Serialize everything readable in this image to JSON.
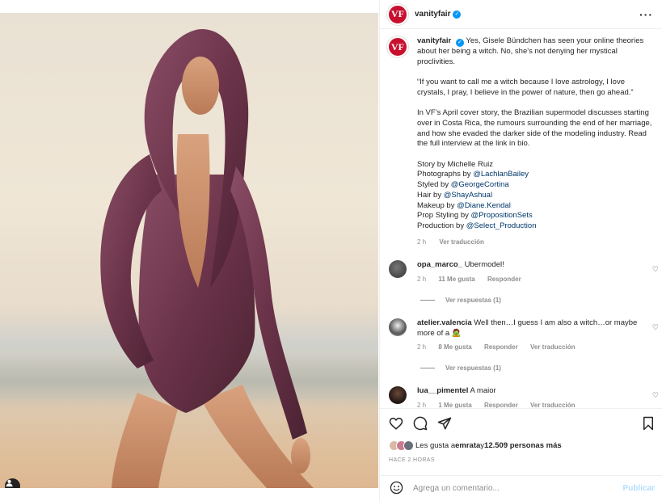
{
  "post": {
    "account": "vanityfair",
    "avatar_text": "VF",
    "brand_color": "#c8102e",
    "verified_color": "#0095f6",
    "photo_alt_icon": "user-tag-icon"
  },
  "caption": {
    "username": "vanityfair",
    "intro": "Yes, Gisele Bündchen has seen your online theories about her being a witch. No, she's not denying her mystical proclivities.",
    "quote": "“If you want to call me a witch because I love astrology, I love crystals, I pray, I believe in the power of nature, then go ahead.”",
    "story": "In VF’s April cover story, the Brazilian supermodel discusses starting over in Costa Rica, the rumours surrounding the end of her marriage, and how she evaded the darker side of the modeling industry. Read the full interview at the link in bio.",
    "credits": [
      {
        "label": "Story by Michelle Ruiz",
        "handle": ""
      },
      {
        "label": "Photographs by ",
        "handle": "@LachlanBailey"
      },
      {
        "label": "Styled by ",
        "handle": "@GeorgeCortina"
      },
      {
        "label": "Hair by ",
        "handle": "@ShayAshual"
      },
      {
        "label": "Makeup by ",
        "handle": "@Diane.Kendal"
      },
      {
        "label": "Prop Styling by ",
        "handle": "@PropositionSets"
      },
      {
        "label": "Production by ",
        "handle": "@Select_Production"
      }
    ],
    "time": "2 h",
    "translate": "Ver traducción"
  },
  "comments": [
    {
      "user": "opa_marco_",
      "text": "Ubermodel!",
      "time": "2 h",
      "likes": "11 Me gusta",
      "reply": "Responder",
      "translate": "",
      "replies": "Ver respuestas (1)"
    },
    {
      "user": "atelier.valencia",
      "text": "Well then…I guess I am also a witch…or maybe more of a 🧟",
      "time": "2 h",
      "likes": "8 Me gusta",
      "reply": "Responder",
      "translate": "Ver traducción",
      "replies": "Ver respuestas (1)"
    },
    {
      "user": "lua__pimentel",
      "text": "A maior",
      "time": "2 h",
      "likes": "1 Me gusta",
      "reply": "Responder",
      "translate": "Ver traducción",
      "replies": ""
    }
  ],
  "actions": {
    "likes_prefix": "Les gusta a ",
    "likes_user": "emrata",
    "likes_mid": " y ",
    "likes_count": "12.509 personas más",
    "timestamp": "HACE 2 HORAS",
    "comment_placeholder": "Agrega un comentario...",
    "publish": "Publicar"
  }
}
